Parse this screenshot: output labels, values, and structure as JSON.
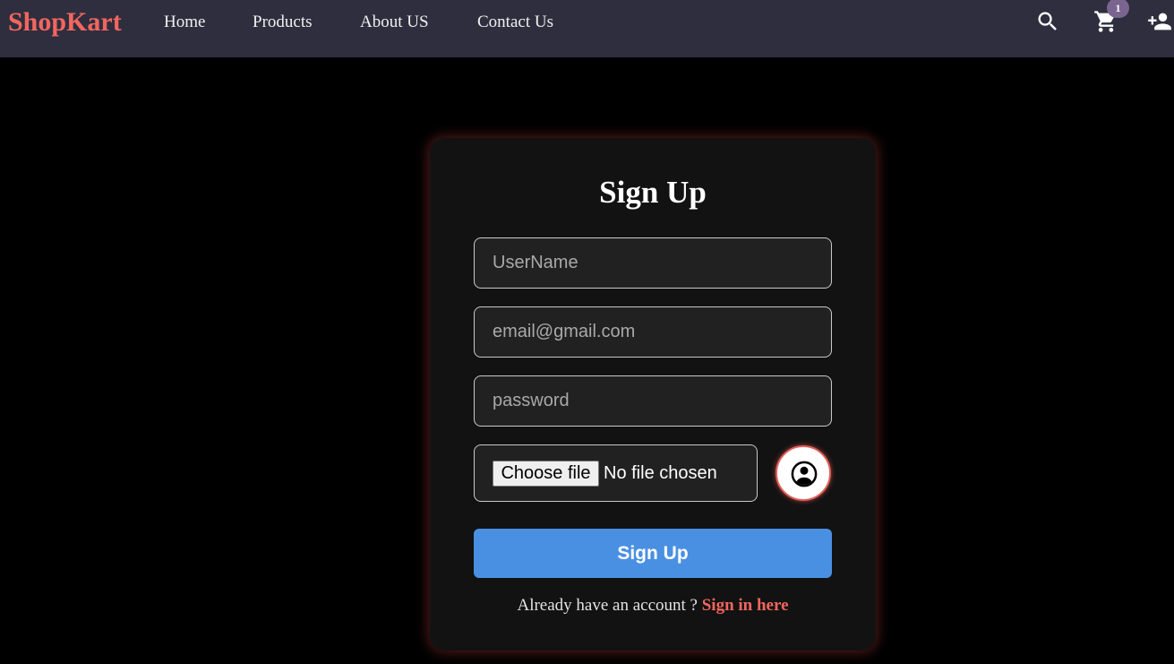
{
  "navbar": {
    "brand": "ShopKart",
    "links": [
      {
        "label": "Home"
      },
      {
        "label": "Products"
      },
      {
        "label": "About US"
      },
      {
        "label": "Contact Us"
      }
    ],
    "icons": {
      "search": "search-icon",
      "cart": "cart-icon",
      "signup": "person-add-icon"
    },
    "cart_count": "1"
  },
  "signup_form": {
    "title": "Sign Up",
    "username_placeholder": "UserName",
    "email_placeholder": "email@gmail.com",
    "password_placeholder": "password",
    "file_button_label": "Choose file",
    "file_status": "No file chosen",
    "avatar_icon": "account-circle-icon",
    "submit_label": "Sign Up",
    "signin_prompt": "Already have an account ?",
    "signin_link_label": "Sign in here"
  },
  "colors": {
    "navbar_bg": "#2e2e3e",
    "brand": "#f2665f",
    "page_bg": "#000000",
    "card_bg": "#121212",
    "submit_button": "#4a90e2",
    "signin_link": "#f2665f",
    "cart_badge": "#7a6590"
  }
}
